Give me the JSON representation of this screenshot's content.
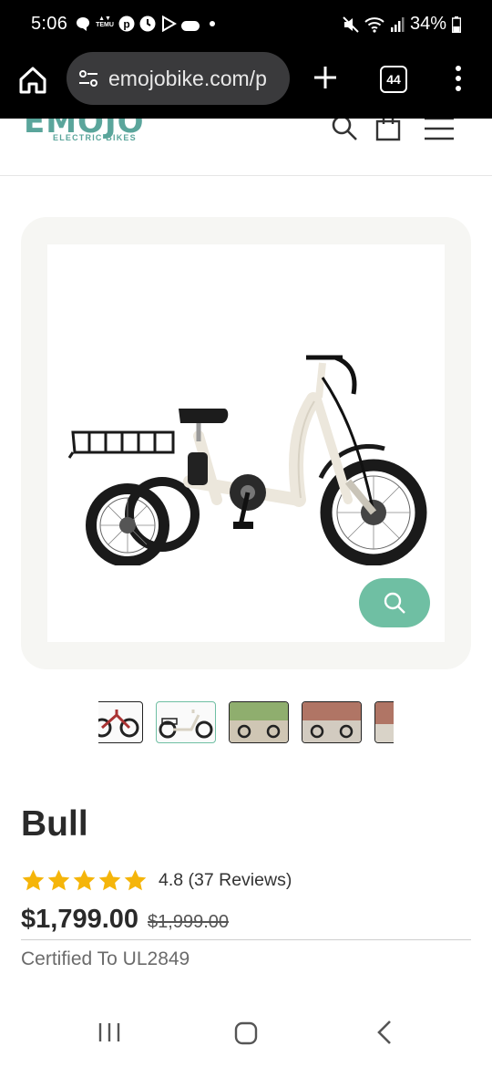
{
  "status_bar": {
    "time": "5:06",
    "battery": "34%",
    "notification_icons": [
      "chat-icon",
      "temu-icon",
      "pinterest-icon",
      "clock-icon",
      "play-icon",
      "cloud-icon",
      "dot-icon"
    ],
    "temu_label": "TEMU"
  },
  "browser": {
    "url": "emojobike.com/p",
    "tab_count": "44"
  },
  "site_header": {
    "logo_text": "EMOJO",
    "logo_subtext": "ELECTRIC BIKES"
  },
  "product": {
    "title": "Bull",
    "rating": 4.8,
    "rating_text": "4.8 (37 Reviews)",
    "stars_filled": 5,
    "price": "$1,799.00",
    "compare_price": "$1,999.00",
    "certification": "Certified To UL2849",
    "thumbnail_count": 5,
    "active_thumbnail": 2
  },
  "colors": {
    "brand_teal": "#5aa59b",
    "zoom_button": "#6fbfa3",
    "star": "#f5b50a",
    "gallery_bg": "#f6f6f3"
  }
}
